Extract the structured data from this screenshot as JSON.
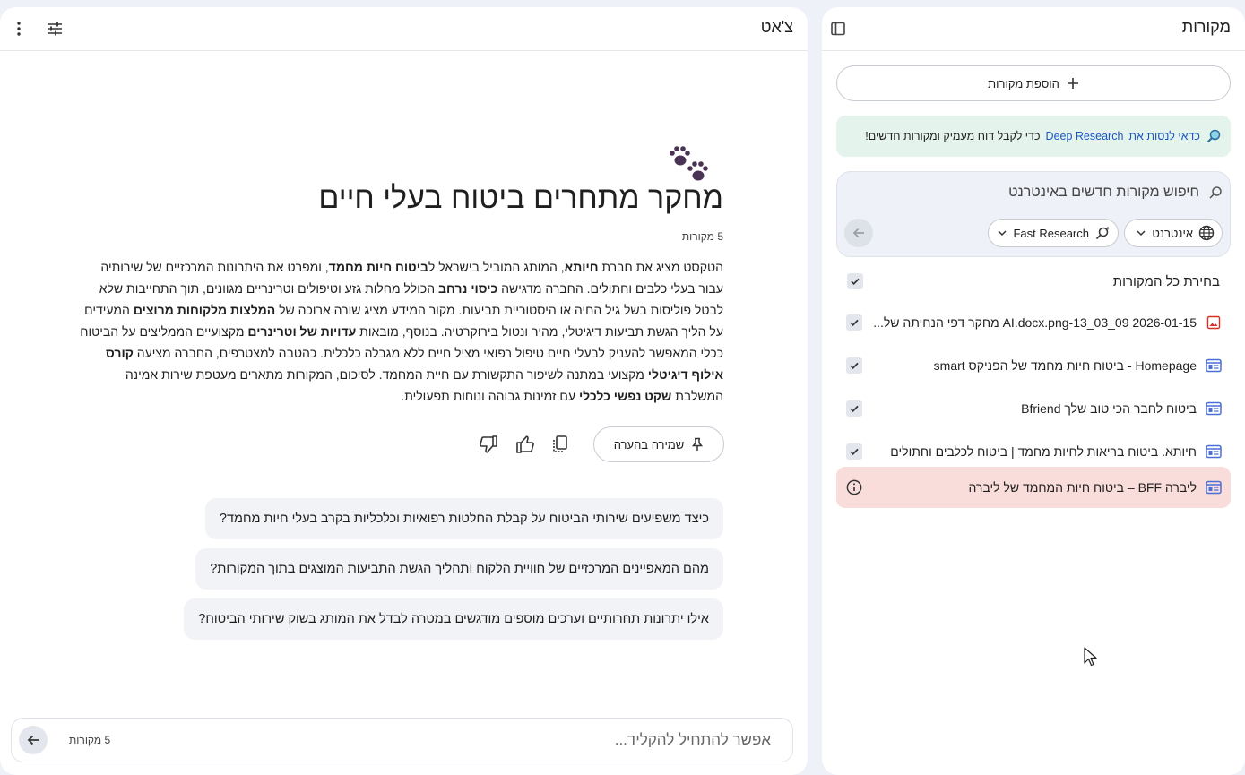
{
  "sources_panel": {
    "title": "מקורות",
    "add_sources_label": "הוספת מקורות",
    "deep_research_banner": {
      "prefix": "כדאי לנסות את",
      "link": "Deep Research",
      "suffix": "כדי לקבל דוח מעמיק ומקורות חדשים!"
    },
    "search": {
      "placeholder": "חיפוש מקורות חדשים באינטרנט",
      "web_chip_label": "אינטרנט",
      "research_chip_label": "Fast Research"
    },
    "select_all_label": "בחירת כל המקורות",
    "items": [
      {
        "label": "2026-01-15 AI.docx.png-13_03_09 מחקר דפי הנחיתה של...",
        "type": "image",
        "checked": true
      },
      {
        "label": "Homepage - ביטוח חיות מחמד של הפניקס smart",
        "type": "web",
        "checked": true
      },
      {
        "label": "ביטוח לחבר הכי טוב שלך Bfriend",
        "type": "web",
        "checked": true
      },
      {
        "label": "חיותא. ביטוח בריאות לחיות מחמד | ביטוח לכלבים וחתולים",
        "type": "web",
        "checked": true
      },
      {
        "label": "ליברה BFF – ביטוח חיות המחמד של ליברה",
        "type": "web",
        "status": "error"
      }
    ]
  },
  "chat_panel": {
    "title": "צ'אט",
    "doc_emoji": "🐾",
    "doc_title": "מחקר מתחרים ביטוח בעלי חיים",
    "doc_source_count": "5 מקורות",
    "summary": {
      "s1": "הטקסט מציג את חברת ",
      "b1": "חיותא",
      "s2": ", המותג המוביל בישראל ל",
      "b2": "ביטוח חיות מחמד",
      "s3": ", ומפרט את היתרונות המרכזיים של שירותיה עבור בעלי כלבים וחתולים. החברה מדגישה ",
      "b3": "כיסוי נרחב",
      "s4": " הכולל מחלות גזע וטיפולים וטרינריים מגוונים, תוך התחייבות שלא לבטל פוליסות בשל גיל החיה או היסטוריית תביעות. מקור המידע מציג שורה ארוכה של ",
      "b4": "המלצות מלקוחות מרוצים",
      "s5": " המעידים על הליך הגשת תביעות דיגיטלי, מהיר ונטול בירוקרטיה. בנוסף, מובאות ",
      "b5": "עדויות של וטרינרים",
      "s6": " מקצועיים הממליצים על הביטוח ככלי המאפשר להעניק לבעלי חיים טיפול רפואי מציל חיים ללא מגבלה כלכלית. כהטבה למצטרפים, החברה מציעה ",
      "b6": "קורס אילוף דיגיטלי",
      "s7": " מקצועי במתנה לשיפור התקשורת עם חיית המחמד. לסיכום, המקורות מתארים מעטפת שירות אמינה המשלבת ",
      "b7": "שקט נפשי כלכלי",
      "s8": " עם זמינות גבוהה ונוחות תפעולית."
    },
    "save_note_label": "שמירה בהערה",
    "suggestions": [
      "כיצד משפיעים שירותי הביטוח על קבלת החלטות רפואיות וכלכליות בקרב בעלי חיות מחמד?",
      "מהם המאפיינים המרכזיים של חוויית הלקוח ותהליך הגשת התביעות המוצגים בתוך המקורות?",
      "אילו יתרונות תחרותיים וערכים מוספים מודגשים במטרה לבדל את המותג בשוק שירותי הביטוח?"
    ],
    "input": {
      "placeholder": "אפשר להתחיל להקליד...",
      "source_count": "5 מקורות"
    }
  },
  "colors": {
    "background": "#eef1f8",
    "banner": "#e4f4ec",
    "link": "#1a56c4",
    "error_row": "#f9ddda",
    "web_icon": "#4a6fd6",
    "image_icon": "#d93025"
  }
}
